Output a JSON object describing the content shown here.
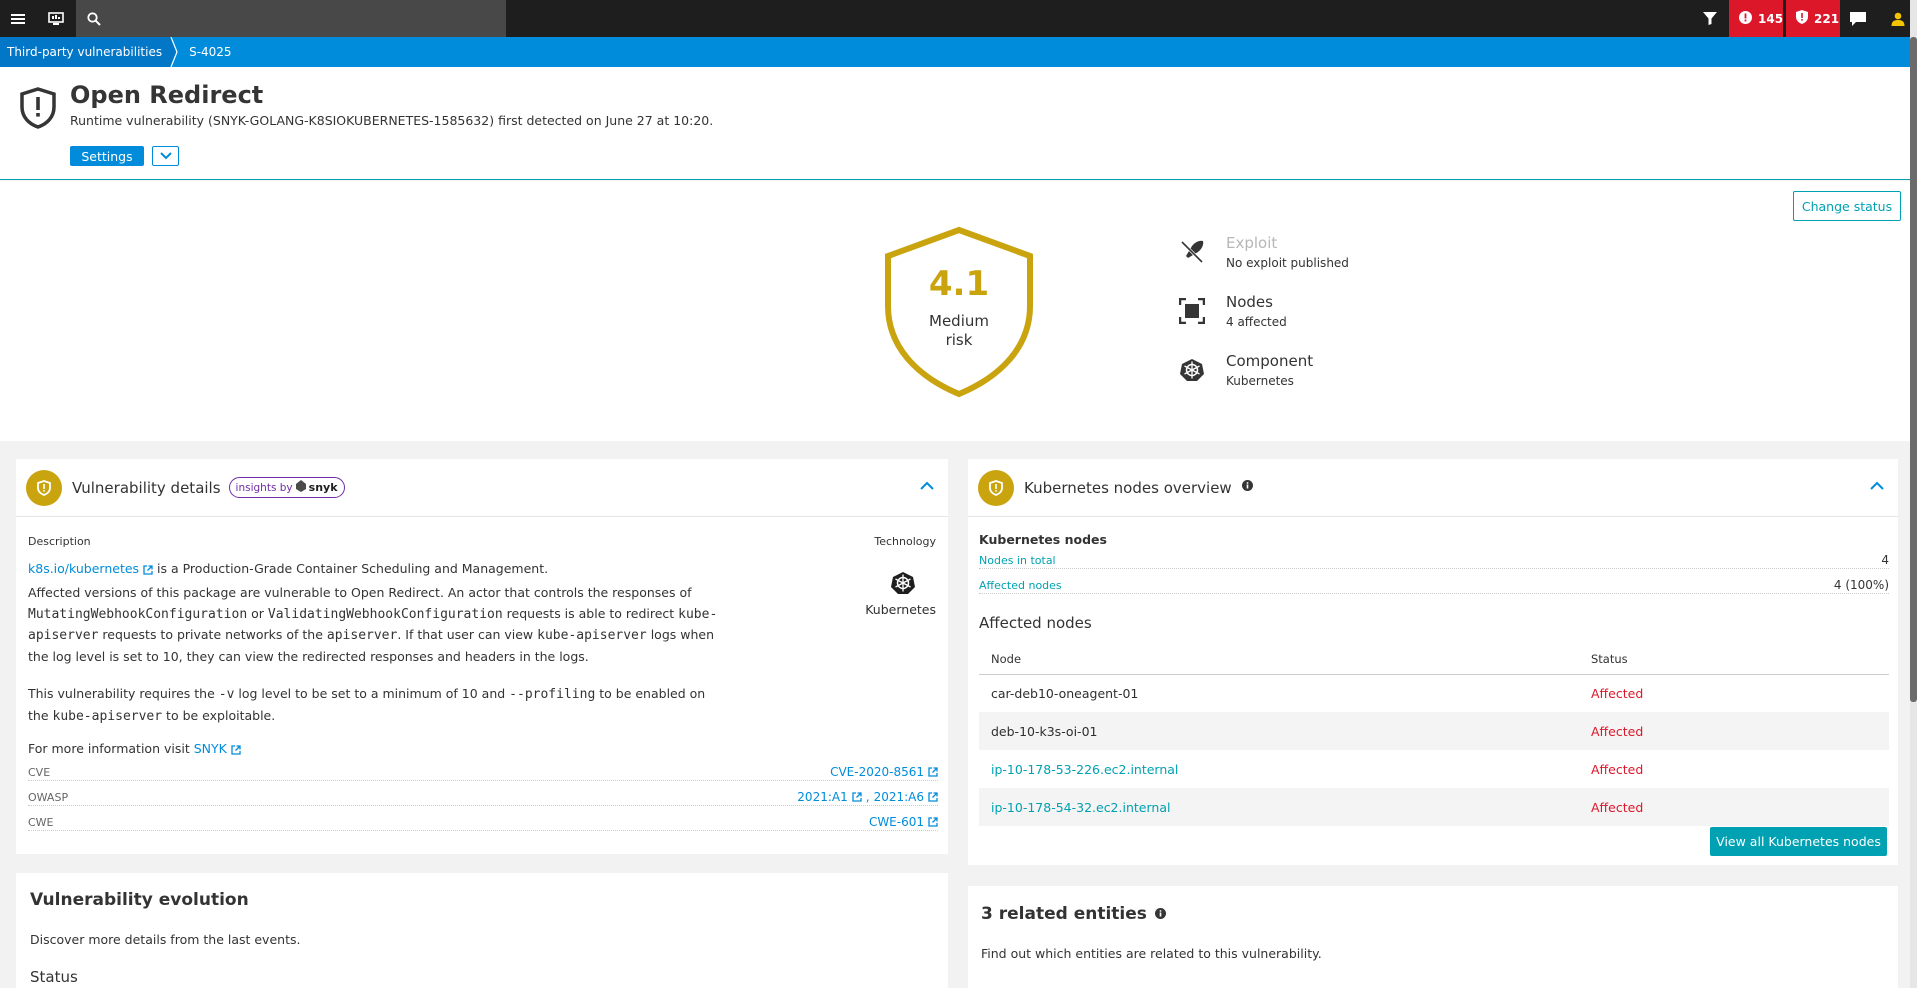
{
  "topbar": {
    "menu_icon": "hamburger-menu-icon",
    "monitor_icon": "monitor-icon",
    "search_icon": "search-icon",
    "filter_icon": "filter-icon",
    "problems_count": "145",
    "vulnerabilities_count": "221",
    "chat_icon": "chat-icon",
    "user_icon": "user-icon"
  },
  "breadcrumb": {
    "parent": "Third-party vulnerabilities",
    "current": "S-4025"
  },
  "header": {
    "title": "Open Redirect",
    "subtitle": "Runtime vulnerability (SNYK-GOLANG-K8SIOKUBERNETES-1585632) first detected on June 27 at 10:20.",
    "settings_label": "Settings"
  },
  "hero": {
    "change_status_label": "Change status",
    "risk_score": "4.1",
    "risk_level_line1": "Medium",
    "risk_level_line2": "risk",
    "facts": [
      {
        "name": "Exploit",
        "value": "No exploit published",
        "icon": "exploit-icon"
      },
      {
        "name": "Nodes",
        "value": "4 affected",
        "icon": "nodes-icon"
      },
      {
        "name": "Component",
        "value": "Kubernetes",
        "icon": "kubernetes-icon"
      }
    ]
  },
  "vuln_details": {
    "title": "Vulnerability details",
    "insights_label": "insights by",
    "insights_brand": "snyk",
    "description_label": "Description",
    "technology_label": "Technology",
    "technology_value": "Kubernetes",
    "package_link": "k8s.io/kubernetes",
    "package_desc": " is a Production-Grade Container Scheduling and Management.",
    "p1_a": "Affected versions of this package are vulnerable to Open Redirect. An actor that controls the responses of ",
    "p1_code1": "MutatingWebhookConfiguration",
    "p1_b": " or ",
    "p1_code2": "ValidatingWebhookConfiguration",
    "p1_c": " requests is able to redirect ",
    "p1_code3": "kube-apiserver",
    "p1_d": " requests to private networks of the ",
    "p1_code4": "apiserver",
    "p1_e": ". If that user can view ",
    "p1_code5": "kube-apiserver",
    "p1_f": " logs when the log level is set to 10, they can view the redirected responses and headers in the logs.",
    "p2_a": "This vulnerability requires the ",
    "p2_code1": "-v",
    "p2_b": " log level to be set to a minimum of 10 and ",
    "p2_code2": "--profiling",
    "p2_c": " to be enabled on the ",
    "p2_code3": "kube-apiserver",
    "p2_d": " to be exploitable.",
    "more_info": "For more information visit ",
    "more_info_link": "SNYK",
    "cve_label": "CVE",
    "cve_value": "CVE-2020-8561",
    "owasp_label": "OWASP",
    "owasp_value_1": "2021:A1",
    "owasp_value_2": "2021:A6",
    "cwe_label": "CWE",
    "cwe_value": "CWE-601"
  },
  "k8s_overview": {
    "title": "Kubernetes nodes overview",
    "section_title": "Kubernetes nodes",
    "nodes_total_label": "Nodes in total",
    "nodes_total_value": "4",
    "affected_label": "Affected nodes",
    "affected_value": "4 (100%)",
    "affected_title": "Affected nodes",
    "columns": [
      "Node",
      "Status"
    ],
    "rows": [
      {
        "node": "car-deb10-oneagent-01",
        "status": "Affected"
      },
      {
        "node": "deb-10-k3s-oi-01",
        "status": "Affected"
      },
      {
        "node": "ip-10-178-53-226.ec2.internal",
        "status": "Affected"
      },
      {
        "node": "ip-10-178-54-32.ec2.internal",
        "status": "Affected"
      }
    ],
    "view_all_label": "View all Kubernetes nodes"
  },
  "evolution": {
    "title": "Vulnerability evolution",
    "desc": "Discover more details from the last events.",
    "status_label": "Status"
  },
  "related": {
    "title": "3 related entities",
    "desc": "Find out which entities are related to this vulnerability."
  },
  "colors": {
    "brand_blue": "#008cdb",
    "teal": "#00a1b2",
    "risk_medium": "#c9a40e",
    "alert_red": "#dc172a"
  }
}
